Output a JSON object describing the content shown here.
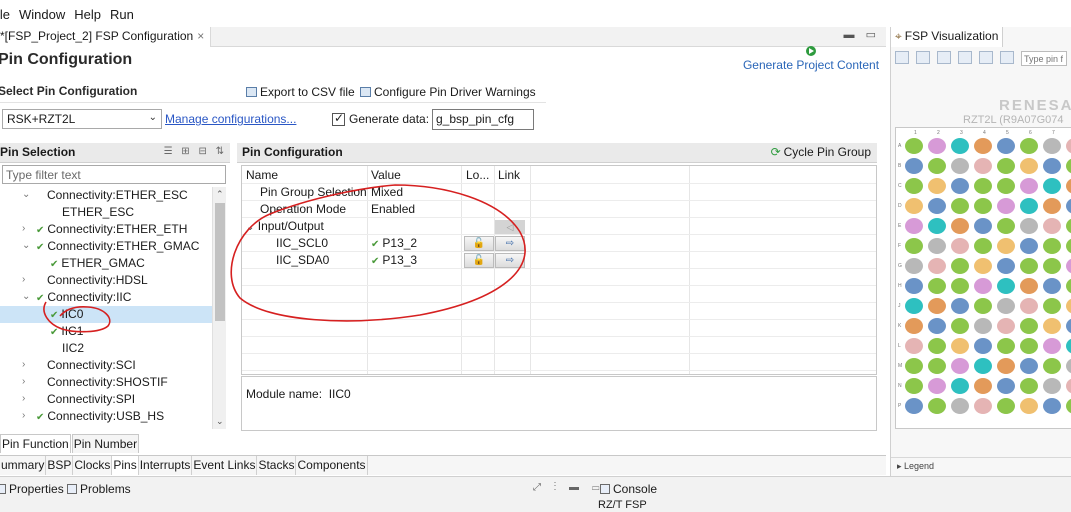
{
  "menu": [
    "ile",
    "Window",
    "Help",
    "Run"
  ],
  "editor_tab": {
    "label": "*[FSP_Project_2] FSP Configuration",
    "close": "×"
  },
  "window_controls": "▬ ▭",
  "page_title": "Pin Configuration",
  "generate_button": "Generate Project Content",
  "select_pin_config_label": "Select Pin Configuration",
  "export_csv": "Export to CSV file",
  "configure_warnings": "Configure Pin Driver Warnings",
  "config_select": {
    "value": "RSK+RZT2L"
  },
  "manage_link": "Manage configurations...",
  "generate_data": {
    "label": "Generate data:",
    "value": "g_bsp_pin_cfg",
    "checked": true
  },
  "pin_selection": {
    "header": "Pin Selection",
    "filter_placeholder": "Type filter text",
    "tree": [
      {
        "label": "Connectivity:ETHER_ESC",
        "indent": 1,
        "twisty": "expanded",
        "checked": false
      },
      {
        "label": "ETHER_ESC",
        "indent": 2,
        "twisty": "",
        "checked": false
      },
      {
        "label": "Connectivity:ETHER_ETH",
        "indent": 1,
        "twisty": "collapsed",
        "checked": true
      },
      {
        "label": "Connectivity:ETHER_GMAC",
        "indent": 1,
        "twisty": "expanded",
        "checked": true
      },
      {
        "label": "ETHER_GMAC",
        "indent": 2,
        "twisty": "",
        "checked": true
      },
      {
        "label": "Connectivity:HDSL",
        "indent": 1,
        "twisty": "collapsed",
        "checked": false
      },
      {
        "label": "Connectivity:IIC",
        "indent": 1,
        "twisty": "expanded",
        "checked": true
      },
      {
        "label": "IIC0",
        "indent": 2,
        "twisty": "",
        "checked": true,
        "selected": true
      },
      {
        "label": "IIC1",
        "indent": 2,
        "twisty": "",
        "checked": true
      },
      {
        "label": "IIC2",
        "indent": 2,
        "twisty": "",
        "checked": false
      },
      {
        "label": "Connectivity:SCI",
        "indent": 1,
        "twisty": "collapsed",
        "checked": false
      },
      {
        "label": "Connectivity:SHOSTIF",
        "indent": 1,
        "twisty": "collapsed",
        "checked": false
      },
      {
        "label": "Connectivity:SPI",
        "indent": 1,
        "twisty": "collapsed",
        "checked": false
      },
      {
        "label": "Connectivity:USB_HS",
        "indent": 1,
        "twisty": "collapsed",
        "checked": true
      }
    ]
  },
  "pin_config": {
    "header": "Pin Configuration",
    "cycle": "Cycle Pin Group",
    "columns": [
      "Name",
      "Value",
      "Lo...",
      "Link"
    ],
    "rows": [
      {
        "name": "Pin Group Selection",
        "value": "Mixed"
      },
      {
        "name": "Operation Mode",
        "value": "Enabled"
      },
      {
        "name": "Input/Output",
        "value": ""
      },
      {
        "name": "IIC_SCL0",
        "value": "P13_2"
      },
      {
        "name": "IIC_SDA0",
        "value": "P13_3"
      }
    ],
    "module_name_label": "Module name:",
    "module_name": "IIC0"
  },
  "pin_tabs": [
    "Pin Function",
    "Pin Number"
  ],
  "config_tabs": [
    "ummary",
    "BSP",
    "Clocks",
    "Pins",
    "Interrupts",
    "Event Links",
    "Stacks",
    "Components"
  ],
  "active_config_tab": "Pins",
  "bottom": {
    "properties": "Properties",
    "problems": "Problems",
    "console": "Console",
    "console_sub": "RZ/T FSP"
  },
  "viz": {
    "tab": "FSP Visualization",
    "search_placeholder": "Type pin f",
    "brand": "RENESA",
    "chip": "RZT2L (R9A07G074",
    "columns": [
      "1",
      "2",
      "3",
      "4",
      "5",
      "6",
      "7",
      "8"
    ],
    "rows": [
      "A",
      "B",
      "C",
      "D",
      "E",
      "F",
      "G",
      "H",
      "J",
      "K",
      "L",
      "M",
      "N",
      "P"
    ],
    "legend": "▸ Legend"
  },
  "colors": {
    "accent_link": "#2a57c5",
    "selected_row": "#cce4f7",
    "annotation": "#d62020",
    "pin_green": "#8cc64a",
    "pin_blue": "#6a93c7",
    "pin_orange": "#e39a5a"
  }
}
